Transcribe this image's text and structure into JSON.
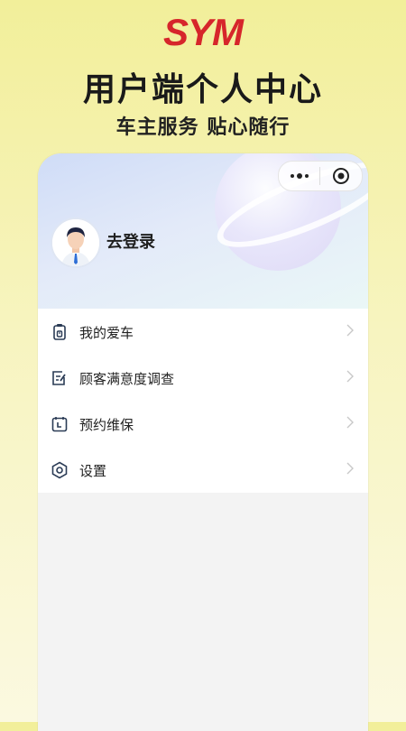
{
  "brand": {
    "logo_text": "SYM",
    "color": "#d6262b"
  },
  "headline": "用户端个人中心",
  "subline": "车主服务 贴心随行",
  "capsule": {
    "more_icon": "more-dots-icon",
    "close_icon": "target-circle-icon"
  },
  "profile": {
    "login_label": "去登录",
    "avatar_icon": "user-avatar-icon"
  },
  "menu": {
    "items": [
      {
        "label": "我的爱车",
        "icon": "car-key-icon"
      },
      {
        "label": "顾客满意度调查",
        "icon": "survey-icon"
      },
      {
        "label": "预约维保",
        "icon": "calendar-icon"
      },
      {
        "label": "设置",
        "icon": "settings-icon"
      }
    ]
  },
  "colors": {
    "accent": "#2a3b55",
    "chevron": "#c8c8c8"
  }
}
